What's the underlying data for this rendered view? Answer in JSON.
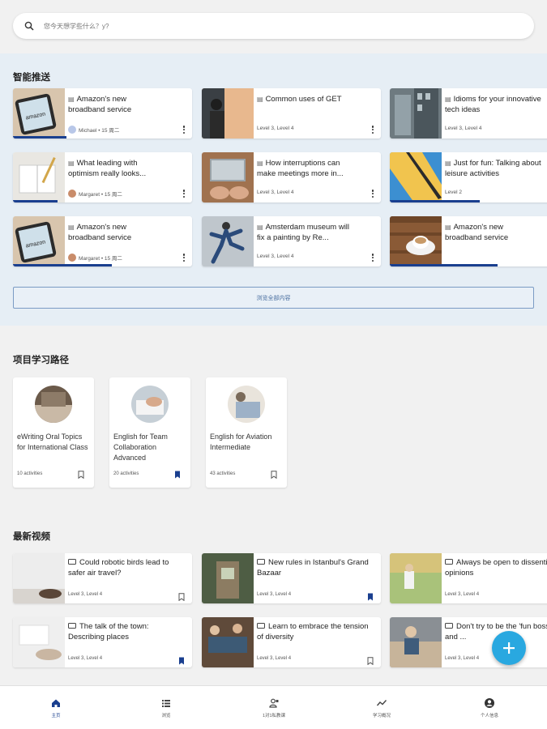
{
  "search": {
    "placeholder": "您今天想学些什么？y?"
  },
  "recommend": {
    "title": "智能推送",
    "view_all_label": "浏览全部内容",
    "cards": [
      {
        "title": "Amazon's new broadband service",
        "meta": "Michael • 15 周二",
        "has_avatar": true
      },
      {
        "title": "Common uses of GET",
        "meta": "Level 3, Level 4",
        "has_avatar": false
      },
      {
        "title": "Idioms for your innovative tech ideas",
        "meta": "Level 3, Level 4",
        "has_avatar": false
      },
      {
        "title": "What leading with optimism really looks...",
        "meta": "Margaret • 15 周二",
        "has_avatar": true
      },
      {
        "title": "How interruptions can make meetings more in...",
        "meta": "Level 3, Level 4",
        "has_avatar": false
      },
      {
        "title": "Just for fun: Talking about leisure activities",
        "meta": "Level 2",
        "has_avatar": false
      },
      {
        "title": "Amazon's new broadband service",
        "meta": "Margaret • 15 周二",
        "has_avatar": true
      },
      {
        "title": "Amsterdam museum will fix a painting by Re...",
        "meta": "Level 3, Level 4",
        "has_avatar": false
      },
      {
        "title": "Amazon's new broadband service",
        "meta": "",
        "has_avatar": false
      }
    ]
  },
  "paths": {
    "title": "项目学习路径",
    "items": [
      {
        "title": "eWriting Oral Topics for International Class",
        "count": "10 activities",
        "saved": false
      },
      {
        "title": "English for Team Collaboration Advanced",
        "count": "20 activities",
        "saved": true
      },
      {
        "title": "English for Aviation Intermediate",
        "count": "43 activities",
        "saved": false
      }
    ]
  },
  "videos": {
    "title": "最新视频",
    "items": [
      {
        "title": "Could robotic birds lead to safer air travel?",
        "meta": "Level 3, Level 4",
        "saved": false
      },
      {
        "title": "New rules in Istanbul's Grand Bazaar",
        "meta": "Level 3, Level 4",
        "saved": true
      },
      {
        "title": "Always be open to dissenting opinions",
        "meta": "Level 3, Level 4",
        "saved": false
      },
      {
        "title": "The talk of the town: Describing places",
        "meta": "Level 3, Level 4",
        "saved": true
      },
      {
        "title": "Learn to embrace the tension of diversity",
        "meta": "Level 3, Level 4",
        "saved": false
      },
      {
        "title": "Don't try to be the 'fun boss' -- and ...",
        "meta": "Level 3, Level 4",
        "saved": false
      }
    ]
  },
  "nav": {
    "items": [
      {
        "label": "主页",
        "icon": "home-icon"
      },
      {
        "label": "浏览",
        "icon": "list-icon"
      },
      {
        "label": "1对1私教课",
        "icon": "tutor-icon"
      },
      {
        "label": "学习概况",
        "icon": "trend-icon"
      },
      {
        "label": "个人信息",
        "icon": "profile-icon"
      }
    ]
  },
  "colors": {
    "accent": "#1a3f8f",
    "fab": "#29a8e0",
    "rec_bg": "#e6eef5"
  }
}
